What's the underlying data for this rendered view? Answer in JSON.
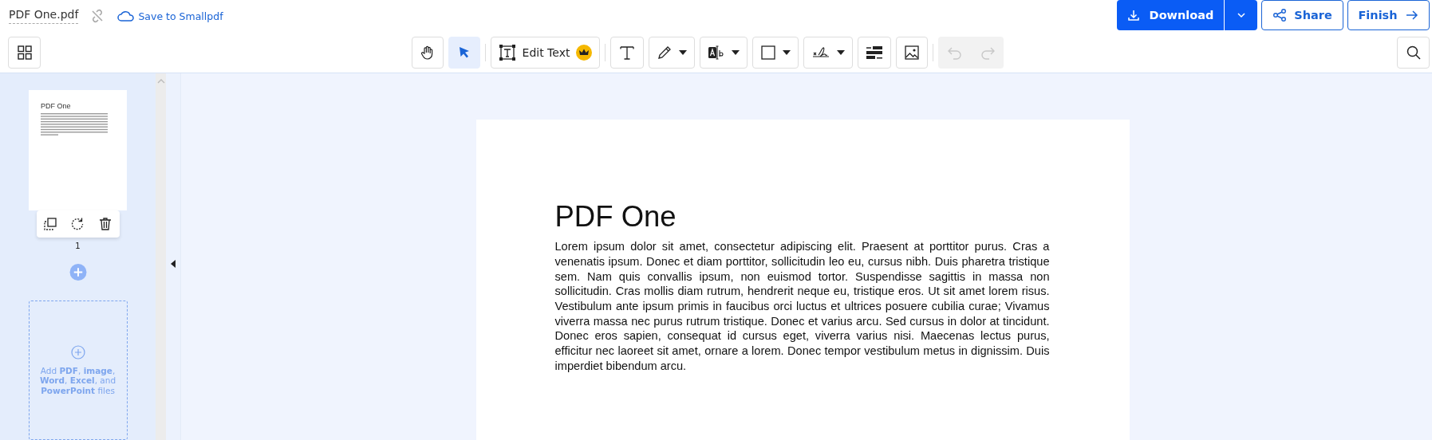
{
  "header": {
    "file_name": "PDF One.pdf",
    "save_link": "Save to Smallpdf",
    "download": "Download",
    "share": "Share",
    "finish": "Finish"
  },
  "toolbar": {
    "tools": [
      {
        "kind": "hand",
        "selected": false,
        "dropdown": false
      },
      {
        "kind": "select",
        "selected": true,
        "dropdown": false
      },
      {
        "kind": "edit-text",
        "label": "Edit Text",
        "selected": false,
        "dropdown": false
      },
      {
        "kind": "text",
        "selected": false,
        "dropdown": false
      },
      {
        "kind": "pencil",
        "selected": false,
        "dropdown": true
      },
      {
        "kind": "text-field",
        "selected": false,
        "dropdown": true
      },
      {
        "kind": "shape",
        "selected": false,
        "dropdown": true
      },
      {
        "kind": "sign",
        "selected": false,
        "dropdown": true
      },
      {
        "kind": "form",
        "selected": false,
        "dropdown": false
      },
      {
        "kind": "image",
        "selected": false,
        "dropdown": false
      }
    ],
    "history": [
      {
        "kind": "undo",
        "disabled": true
      },
      {
        "kind": "redo",
        "disabled": true
      }
    ]
  },
  "sidebar": {
    "pages": [
      {
        "thumbnail_title": "PDF One",
        "number": "1"
      }
    ],
    "add_files": "Add **PDF**, **image**, **Word**, **Excel**, and **PowerPoint** files"
  },
  "document": {
    "title": "PDF One",
    "body": "Lorem ipsum dolor sit amet, consectetur adipiscing elit. Praesent at porttitor purus. Cras a venenatis ipsum. Donec et diam porttitor, sollicitudin leo eu, cursus nibh. Duis pharetra tristique sem. Nam quis convallis ipsum, non euismod tortor. Suspendisse sagittis in massa non sollicitudin. Cras mollis diam rutrum, hendrerit neque eu, tristique eros. Ut sit amet lorem risus. Vestibulum ante ipsum primis in faucibus orci luctus et ultrices posuere cubilia curae; Vivamus viverra massa nec purus rutrum tristique. Donec et varius arcu. Sed cursus in dolor at tincidunt. Donec eros sapien, consequat id cursus eget, viverra varius nisi. Maecenas lectus purus, efficitur nec laoreet sit amet, ornare a lorem. Donec tempor vestibulum metus in dignissim. Duis imperdiet bibendum arcu."
  }
}
